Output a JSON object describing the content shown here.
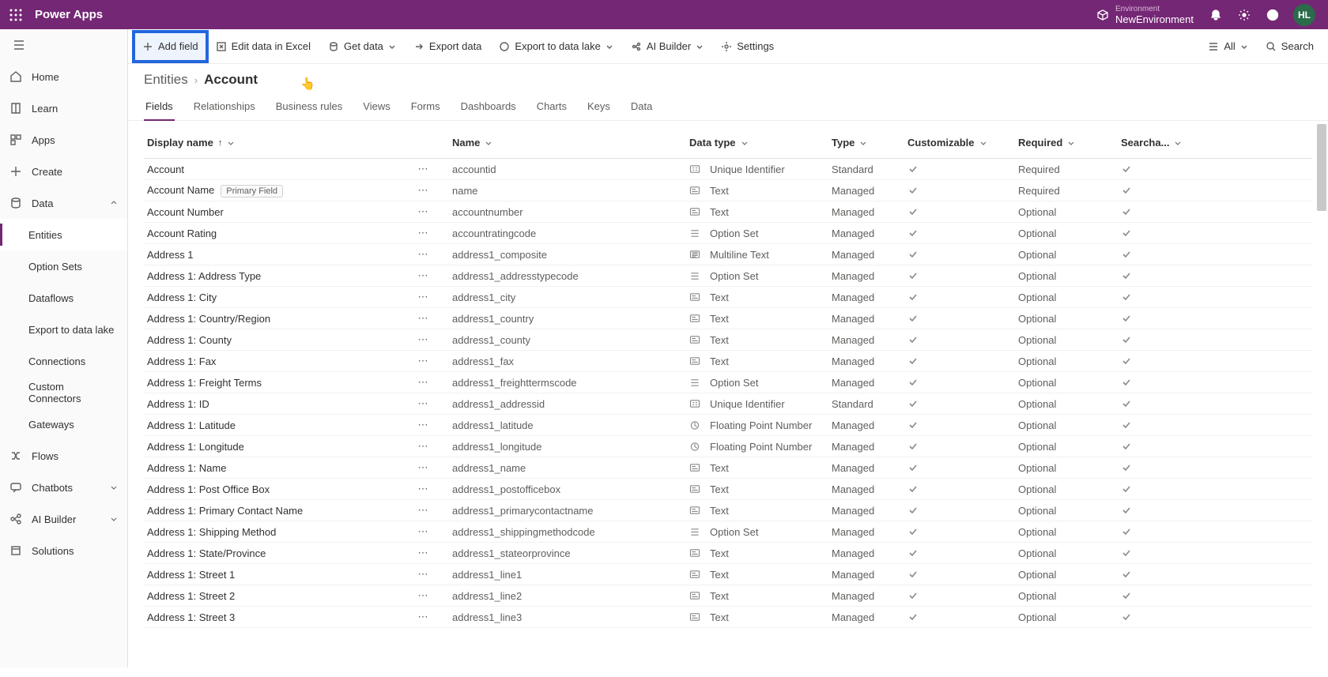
{
  "app": {
    "name": "Power Apps"
  },
  "environment": {
    "label": "Environment",
    "name": "NewEnvironment"
  },
  "avatar": "HL",
  "nav": {
    "home": "Home",
    "learn": "Learn",
    "apps": "Apps",
    "create": "Create",
    "data": "Data",
    "entities": "Entities",
    "optionSets": "Option Sets",
    "dataflows": "Dataflows",
    "export": "Export to data lake",
    "connections": "Connections",
    "customConnectors": "Custom Connectors",
    "gateways": "Gateways",
    "flows": "Flows",
    "chatbots": "Chatbots",
    "aiBuilder": "AI Builder",
    "solutions": "Solutions"
  },
  "cmd": {
    "addField": "Add field",
    "editExcel": "Edit data in Excel",
    "getData": "Get data",
    "exportData": "Export data",
    "exportLake": "Export to data lake",
    "aiBuilder": "AI Builder",
    "settings": "Settings",
    "all": "All",
    "search": "Search"
  },
  "breadcrumb": {
    "root": "Entities",
    "current": "Account"
  },
  "tabs": [
    "Fields",
    "Relationships",
    "Business rules",
    "Views",
    "Forms",
    "Dashboards",
    "Charts",
    "Keys",
    "Data"
  ],
  "columns": {
    "dn": "Display name",
    "nm": "Name",
    "dt": "Data type",
    "ty": "Type",
    "cu": "Customizable",
    "rq": "Required",
    "se": "Searcha..."
  },
  "primaryField": "Primary Field",
  "rows": [
    {
      "dn": "Account",
      "nm": "accountid",
      "dt": "Unique Identifier",
      "dti": "uid",
      "ty": "Standard",
      "cu": true,
      "rq": "Required",
      "se": true,
      "pf": false
    },
    {
      "dn": "Account Name",
      "nm": "name",
      "dt": "Text",
      "dti": "text",
      "ty": "Managed",
      "cu": true,
      "rq": "Required",
      "se": true,
      "pf": true
    },
    {
      "dn": "Account Number",
      "nm": "accountnumber",
      "dt": "Text",
      "dti": "text",
      "ty": "Managed",
      "cu": true,
      "rq": "Optional",
      "se": true,
      "pf": false
    },
    {
      "dn": "Account Rating",
      "nm": "accountratingcode",
      "dt": "Option Set",
      "dti": "opt",
      "ty": "Managed",
      "cu": true,
      "rq": "Optional",
      "se": true,
      "pf": false
    },
    {
      "dn": "Address 1",
      "nm": "address1_composite",
      "dt": "Multiline Text",
      "dti": "mtext",
      "ty": "Managed",
      "cu": true,
      "rq": "Optional",
      "se": true,
      "pf": false
    },
    {
      "dn": "Address 1: Address Type",
      "nm": "address1_addresstypecode",
      "dt": "Option Set",
      "dti": "opt",
      "ty": "Managed",
      "cu": true,
      "rq": "Optional",
      "se": true,
      "pf": false
    },
    {
      "dn": "Address 1: City",
      "nm": "address1_city",
      "dt": "Text",
      "dti": "text",
      "ty": "Managed",
      "cu": true,
      "rq": "Optional",
      "se": true,
      "pf": false
    },
    {
      "dn": "Address 1: Country/Region",
      "nm": "address1_country",
      "dt": "Text",
      "dti": "text",
      "ty": "Managed",
      "cu": true,
      "rq": "Optional",
      "se": true,
      "pf": false
    },
    {
      "dn": "Address 1: County",
      "nm": "address1_county",
      "dt": "Text",
      "dti": "text",
      "ty": "Managed",
      "cu": true,
      "rq": "Optional",
      "se": true,
      "pf": false
    },
    {
      "dn": "Address 1: Fax",
      "nm": "address1_fax",
      "dt": "Text",
      "dti": "text",
      "ty": "Managed",
      "cu": true,
      "rq": "Optional",
      "se": true,
      "pf": false
    },
    {
      "dn": "Address 1: Freight Terms",
      "nm": "address1_freighttermscode",
      "dt": "Option Set",
      "dti": "opt",
      "ty": "Managed",
      "cu": true,
      "rq": "Optional",
      "se": true,
      "pf": false
    },
    {
      "dn": "Address 1: ID",
      "nm": "address1_addressid",
      "dt": "Unique Identifier",
      "dti": "uid",
      "ty": "Standard",
      "cu": true,
      "rq": "Optional",
      "se": true,
      "pf": false
    },
    {
      "dn": "Address 1: Latitude",
      "nm": "address1_latitude",
      "dt": "Floating Point Number",
      "dti": "float",
      "ty": "Managed",
      "cu": true,
      "rq": "Optional",
      "se": true,
      "pf": false
    },
    {
      "dn": "Address 1: Longitude",
      "nm": "address1_longitude",
      "dt": "Floating Point Number",
      "dti": "float",
      "ty": "Managed",
      "cu": true,
      "rq": "Optional",
      "se": true,
      "pf": false
    },
    {
      "dn": "Address 1: Name",
      "nm": "address1_name",
      "dt": "Text",
      "dti": "text",
      "ty": "Managed",
      "cu": true,
      "rq": "Optional",
      "se": true,
      "pf": false
    },
    {
      "dn": "Address 1: Post Office Box",
      "nm": "address1_postofficebox",
      "dt": "Text",
      "dti": "text",
      "ty": "Managed",
      "cu": true,
      "rq": "Optional",
      "se": true,
      "pf": false
    },
    {
      "dn": "Address 1: Primary Contact Name",
      "nm": "address1_primarycontactname",
      "dt": "Text",
      "dti": "text",
      "ty": "Managed",
      "cu": true,
      "rq": "Optional",
      "se": true,
      "pf": false
    },
    {
      "dn": "Address 1: Shipping Method",
      "nm": "address1_shippingmethodcode",
      "dt": "Option Set",
      "dti": "opt",
      "ty": "Managed",
      "cu": true,
      "rq": "Optional",
      "se": true,
      "pf": false
    },
    {
      "dn": "Address 1: State/Province",
      "nm": "address1_stateorprovince",
      "dt": "Text",
      "dti": "text",
      "ty": "Managed",
      "cu": true,
      "rq": "Optional",
      "se": true,
      "pf": false
    },
    {
      "dn": "Address 1: Street 1",
      "nm": "address1_line1",
      "dt": "Text",
      "dti": "text",
      "ty": "Managed",
      "cu": true,
      "rq": "Optional",
      "se": true,
      "pf": false
    },
    {
      "dn": "Address 1: Street 2",
      "nm": "address1_line2",
      "dt": "Text",
      "dti": "text",
      "ty": "Managed",
      "cu": true,
      "rq": "Optional",
      "se": true,
      "pf": false
    },
    {
      "dn": "Address 1: Street 3",
      "nm": "address1_line3",
      "dt": "Text",
      "dti": "text",
      "ty": "Managed",
      "cu": true,
      "rq": "Optional",
      "se": true,
      "pf": false
    }
  ]
}
